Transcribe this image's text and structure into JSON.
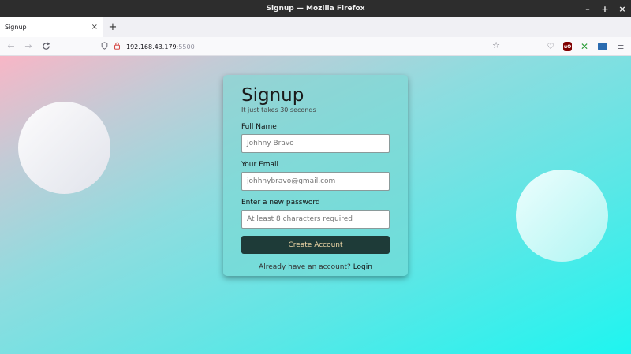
{
  "window": {
    "title": "Signup — Mozilla Firefox",
    "controls": {
      "minimize": "–",
      "maximize": "+",
      "close": "×"
    }
  },
  "tabs": [
    {
      "label": "Signup",
      "close": "×"
    }
  ],
  "new_tab": "+",
  "nav": {
    "back": "←",
    "forward": "→",
    "reload": "C",
    "url_host": "192.168.43.179",
    "url_port": ":5500",
    "star": "☆"
  },
  "toolbar": {
    "pocket": "♡",
    "ublock": "uO",
    "extension_x": "✕",
    "menu": "≡"
  },
  "form": {
    "title": "Signup",
    "subtitle": "It just takes 30 seconds",
    "fields": [
      {
        "label": "Full Name",
        "placeholder": "Johhny Bravo"
      },
      {
        "label": "Your Email",
        "placeholder": "johhnybravo@gmail.com"
      },
      {
        "label": "Enter a new password",
        "placeholder": "At least 8 characters required"
      }
    ],
    "submit_label": "Create Account",
    "login_prompt": "Already have an account?",
    "login_link": "Login"
  }
}
